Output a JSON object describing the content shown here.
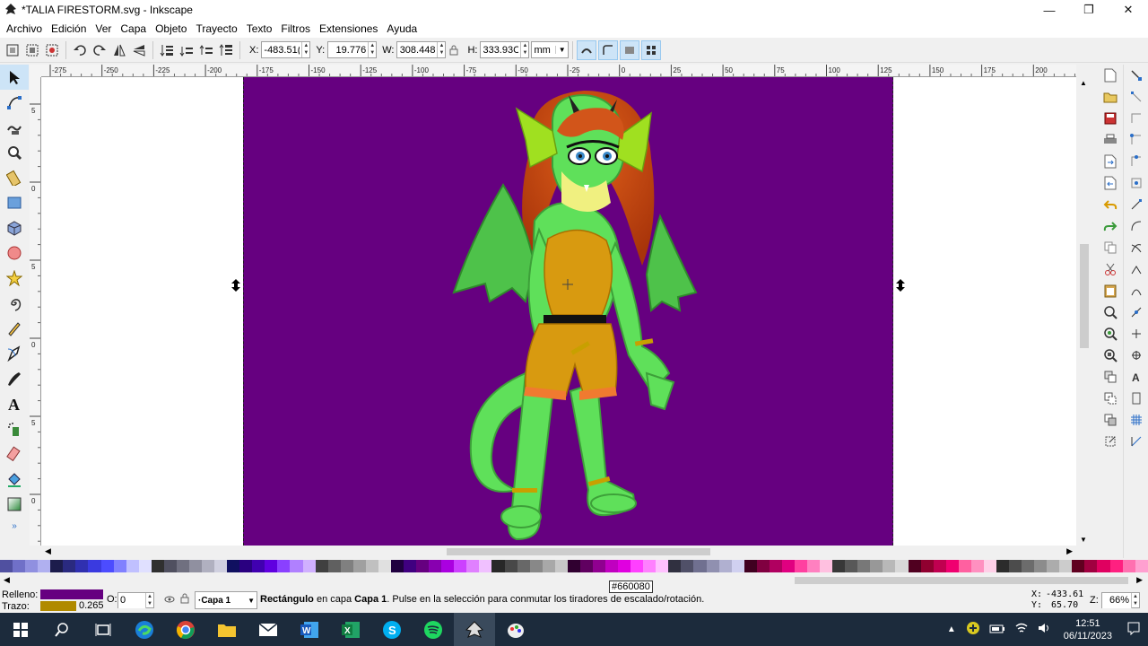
{
  "window": {
    "title": "*TALIA FIRESTORM.svg - Inkscape"
  },
  "menu": [
    "Archivo",
    "Edición",
    "Ver",
    "Capa",
    "Objeto",
    "Trayecto",
    "Texto",
    "Filtros",
    "Extensiones",
    "Ayuda"
  ],
  "toolbar": {
    "x_label": "X:",
    "x_value": "-483.51(",
    "y_label": "Y:",
    "y_value": "19.776",
    "w_label": "W:",
    "w_value": "308.448",
    "h_label": "H:",
    "h_value": "333.93C",
    "unit": "mm"
  },
  "ruler": {
    "h_ticks": [
      "-275",
      "-250",
      "-225",
      "-200",
      "-175",
      "-150",
      "-125",
      "-100",
      "-75",
      "-50",
      "-25",
      "0",
      "25",
      "50",
      "75",
      "100",
      "125",
      "150",
      "175",
      "200"
    ],
    "v_ticks": [
      "5",
      "0",
      "5",
      "0",
      "5",
      "0"
    ]
  },
  "canvas": {
    "page_color": "#660080",
    "character": "TALIA FIRESTORM"
  },
  "palette": [
    "#5050a0",
    "#7070c8",
    "#9090e0",
    "#b0b0f0",
    "#1c1c4c",
    "#2a2a80",
    "#3030b0",
    "#3a3ae0",
    "#4c4cff",
    "#8080ff",
    "#c0c0ff",
    "#e0e0ff",
    "#303030",
    "#505060",
    "#707080",
    "#9090a0",
    "#b0b0c0",
    "#d0d0e0",
    "#101060",
    "#2a0080",
    "#4000b0",
    "#6000e0",
    "#8a40ff",
    "#b080ff",
    "#d0b0ff",
    "#404040",
    "#606060",
    "#808080",
    "#a0a0a0",
    "#c0c0c0",
    "#e0e0e0",
    "#200040",
    "#400080",
    "#660080",
    "#8800b0",
    "#aa00e0",
    "#cc40ff",
    "#e080ff",
    "#f0c0ff",
    "#282828",
    "#484848",
    "#686868",
    "#888888",
    "#a8a8a8",
    "#c8c8c8",
    "#300030",
    "#600060",
    "#900090",
    "#c000c0",
    "#e000e0",
    "#ff40ff",
    "#ff80ff",
    "#ffc0ff",
    "#303040",
    "#505068",
    "#707090",
    "#9090b0",
    "#b0b0d0",
    "#d0d0f0",
    "#400020",
    "#800040",
    "#b00060",
    "#e00080",
    "#ff40a0",
    "#ff80c0",
    "#ffc0e0",
    "#383838",
    "#585858",
    "#787878",
    "#989898",
    "#b8b8b8",
    "#d8d8d8",
    "#500020",
    "#900030",
    "#c00050",
    "#f00070",
    "#ff60a0",
    "#ff90c0",
    "#ffd0e8",
    "#2c2c2c",
    "#4c4c4c",
    "#6c6c6c",
    "#8c8c8c",
    "#acacac",
    "#cccccc",
    "#600020",
    "#a00040",
    "#e00060",
    "#ff2080",
    "#ff70b0",
    "#ffa0d0"
  ],
  "status": {
    "fill_label": "Relleno:",
    "stroke_label": "Trazo:",
    "fill_color": "#660080",
    "stroke_color": "#b08a00",
    "stroke_width": "0.265",
    "opacity_label": "O:",
    "opacity_value": "0",
    "layer": "·Capa 1",
    "message_bold1": "Rectángulo",
    "message_mid": " en capa ",
    "message_bold2": "Capa 1",
    "message_rest": ". Pulse en la selección para conmutar los tiradores de escalado/rotación.",
    "tooltip": "#660080",
    "cursor_x_label": "X:",
    "cursor_x": "-433.61",
    "cursor_y_label": "Y:",
    "cursor_y": "65.70",
    "zoom_label": "Z:",
    "zoom": "66%"
  },
  "taskbar": {
    "apps": [
      "start-icon",
      "search-icon",
      "task-view-icon",
      "edge-icon",
      "chrome-icon",
      "file-explorer-icon",
      "mail-icon",
      "word-icon",
      "excel-icon",
      "skype-icon",
      "spotify-icon",
      "inkscape-icon",
      "paint-icon"
    ],
    "time": "12:51",
    "date": "06/11/2023"
  }
}
